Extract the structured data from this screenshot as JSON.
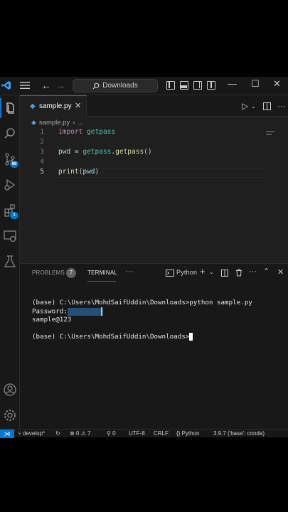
{
  "titlebar": {
    "search_text": "Downloads",
    "nav_back": "←",
    "nav_forward": "→"
  },
  "activity": {
    "source_control_badge": "88",
    "extensions_badge": "1"
  },
  "tabs": [
    {
      "label": "sample.py",
      "icon": "python-file-icon"
    }
  ],
  "breadcrumb": {
    "file": "sample.py",
    "rest": "..."
  },
  "editor": {
    "lines": [
      {
        "num": "1"
      },
      {
        "num": "2"
      },
      {
        "num": "3"
      },
      {
        "num": "4"
      },
      {
        "num": "5"
      }
    ],
    "code": {
      "l1_kw": "import",
      "l1_mod": "getpass",
      "l3_var": "pwd",
      "l3_eq": " = ",
      "l3_obj": "getpass",
      "l3_dot": ".",
      "l3_fn": "getpass",
      "l3_paren": "()",
      "l5_fn": "print",
      "l5_open": "(",
      "l5_arg": "pwd",
      "l5_close": ")"
    }
  },
  "panel": {
    "tabs": {
      "problems": "PROBLEMS",
      "problems_count": "7",
      "terminal": "TERMINAL",
      "more": "···"
    },
    "shell": "Python",
    "terminal_lines": {
      "cmd": "(base) C:\\Users\\MohdSaifUddin\\Downloads>python sample.py",
      "password_prompt": "Password:",
      "output": "sample@123",
      "prompt": "(base) C:\\Users\\MohdSaifUddin\\Downloads>"
    }
  },
  "status": {
    "remote": "⋊",
    "branch": "develop*",
    "sync": "↻",
    "problems": "⊗ 0 ⚠ 7",
    "ports": "⚲ 0",
    "encoding": "UTF-8",
    "eol": "CRLF",
    "language": "Python",
    "interpreter": "3.9.7 ('base': conda)"
  },
  "colors": {
    "accent": "#0078d4",
    "background": "#1f1f1f",
    "keyword": "#c586c0",
    "module": "#4ec9b0",
    "variable": "#9cdcfe",
    "function": "#dcdcaa"
  }
}
